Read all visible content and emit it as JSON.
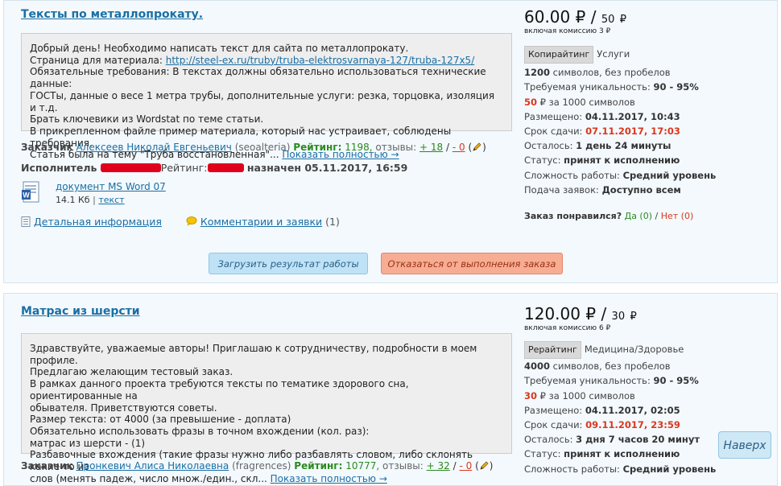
{
  "order1": {
    "title": "Тексты по металлопрокату.",
    "desc_lines": [
      "Добрый день! Необходимо написать текст для сайта по металлопрокату.",
      "Страница для материала: ",
      "Обязательные требования: В текстах должны обязательно использоваться технические данные:",
      "ГОСТы, данные о весе 1 метра трубы, дополнительные услуги: резка, торцовка, изоляция и т.д.",
      "Брать ключевики из Wordstat по теме статьи.",
      "В прикрепленном файле пример материала, который нас устраивает, соблюдены требования.",
      "Статья была на тему \"Труба восстановленная\"... "
    ],
    "desc_link": "http://steel-ex.ru/truby/truba-elektrosvarnaya-127/truba-127x5/",
    "show_more": "Показать полностью →",
    "customer_label": "Заказчик",
    "customer_name": "Алексеев Николай Евгеньевич",
    "customer_login": "(seoalteria)",
    "rating_label": "Рейтинг:",
    "rating_value": "1198,",
    "reviews_label": "отзывы:",
    "reviews_plus": "+ 18",
    "reviews_sep": "/",
    "reviews_minus": "- 0",
    "reviews_open": "(",
    "reviews_close": ")",
    "executor_label": "Исполнитель",
    "executor_rating_label": "Рейтинг:",
    "assigned_text": "назначен 05.11.2017, 16:59",
    "file_name": "документ MS Word 07",
    "file_size": "14.1 Кб",
    "file_sep": "|",
    "file_text_link": "текст",
    "details_link": "Детальная информация",
    "comments_link": "Комментарии и заявки",
    "comments_count": "(1)",
    "btn_upload": "Загрузить результат работы",
    "btn_refuse": "Отказаться от выполнения заказа",
    "price": "60.00",
    "currency": "₽",
    "price_sep": "/",
    "price_small": "50",
    "commission": "включая комиссию 3 ₽",
    "category_badge": "Копирайтинг",
    "category_sub": "Услуги",
    "chars": "1200",
    "chars_text": "символов, без пробелов",
    "uniq_label": "Требуемая уникальность:",
    "uniq_value": "90 - 95%",
    "per1000_value": "50",
    "per1000_text": "₽ за 1000 символов",
    "placed_label": "Размещено:",
    "placed_value": "04.11.2017, 10:43",
    "deadline_label": "Срок сдачи:",
    "deadline_value": "07.11.2017, 17:03",
    "left_label": "Осталось:",
    "left_value": "1 день 24 минуты",
    "status_label": "Статус:",
    "status_value": "принят к исполнению",
    "complexity_label": "Сложность работы:",
    "complexity_value": "Средний уровень",
    "apply_label": "Подача заявок:",
    "apply_value": "Доступно всем",
    "liked_label": "Заказ понравился?",
    "liked_yes": "Да (0)",
    "liked_sep": "/",
    "liked_no": "Нет (0)"
  },
  "order2": {
    "title": "Матрас из шерсти",
    "desc_lines": [
      "Здравствуйте, уважаемые авторы! Приглашаю к сотрудничеству, подробности в моем профиле.",
      "Предлагаю желающим тестовый заказ.",
      "В рамках данного проекта требуются тексты по тематике здорового сна, ориентированные на",
      "обывателя. Приветствуются советы.",
      "Размер текста: от 4000 (за превышение - доплата)",
      "Обязательно использовать фразы в точном вхождении (кол. раз):",
      "матрас из шерсти - (1)",
      "Разбавочные вхождения (такие фразы нужно либо разбавлять словом, либо склонять какие-то из",
      "слов (менять падеж, число множ./един., скл... "
    ],
    "show_more": "Показать полностью →",
    "customer_label": "Заказчик",
    "customer_name": "Пронкевич Алиса Николаевна",
    "customer_login": "(fragrences)",
    "rating_label": "Рейтинг:",
    "rating_value": "10777,",
    "reviews_label": "отзывы:",
    "reviews_plus": "+ 32",
    "reviews_sep": "/",
    "reviews_minus": "- 0",
    "reviews_open": "(",
    "reviews_close": ")",
    "price": "120.00",
    "currency": "₽",
    "price_sep": "/",
    "price_small": "30",
    "commission": "включая комиссию 6 ₽",
    "category_badge": "Рерайтинг",
    "category_sub": "Медицина/Здоровье",
    "chars": "4000",
    "chars_text": "символов, без пробелов",
    "uniq_label": "Требуемая уникальность:",
    "uniq_value": "90 - 95%",
    "per1000_value": "30",
    "per1000_text": "₽ за 1000 символов",
    "placed_label": "Размещено:",
    "placed_value": "04.11.2017, 02:05",
    "deadline_label": "Срок сдачи:",
    "deadline_value": "09.11.2017, 23:59",
    "left_label": "Осталось:",
    "left_value": "3 дня 7 часов 20 минут",
    "status_label": "Статус:",
    "status_value": "принят к исполнению",
    "complexity_label": "Сложность работы:",
    "complexity_value": "Средний уровень"
  },
  "scroll_top_label": "Наверх",
  "colors": {
    "link": "#1a6fa5",
    "green": "#2c8a1e",
    "red": "#d9381e"
  },
  "icons": [
    "word-document-icon",
    "details-icon",
    "comment-bubble-icon",
    "pencil-icon"
  ]
}
